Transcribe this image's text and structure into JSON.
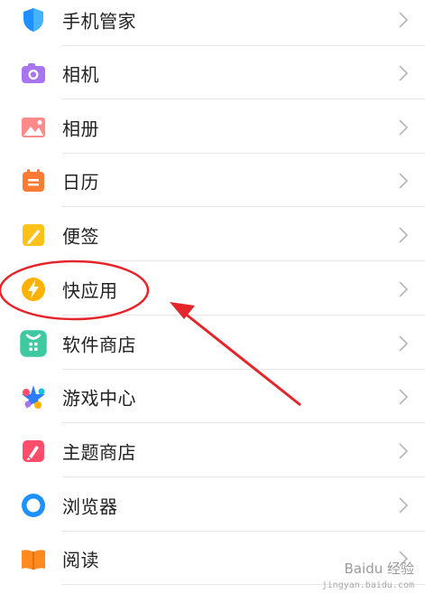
{
  "settings_list": [
    {
      "label": "手机管家",
      "icon": "shield-icon"
    },
    {
      "label": "相机",
      "icon": "camera-icon"
    },
    {
      "label": "相册",
      "icon": "gallery-icon"
    },
    {
      "label": "日历",
      "icon": "calendar-icon"
    },
    {
      "label": "便签",
      "icon": "notes-icon"
    },
    {
      "label": "快应用",
      "icon": "quick-app-icon"
    },
    {
      "label": "软件商店",
      "icon": "app-store-icon"
    },
    {
      "label": "游戏中心",
      "icon": "game-center-icon"
    },
    {
      "label": "主题商店",
      "icon": "theme-store-icon"
    },
    {
      "label": "浏览器",
      "icon": "browser-icon"
    },
    {
      "label": "阅读",
      "icon": "reading-icon"
    }
  ],
  "annotation": {
    "highlighted_item": "快应用",
    "color": "#e4262b"
  },
  "watermark": {
    "text": "Baidu 经验",
    "subtext": "jingyan.baidu.com"
  }
}
